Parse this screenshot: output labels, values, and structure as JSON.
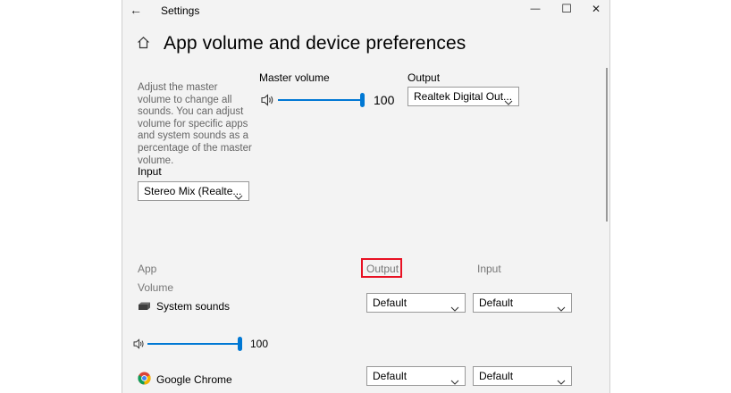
{
  "window": {
    "title": "Settings",
    "back_glyph": "←",
    "minimize_glyph": "—",
    "maximize_glyph": "☐",
    "close_glyph": "✕"
  },
  "header": {
    "home_icon": "home-icon",
    "title": "App volume and device preferences"
  },
  "description": "Adjust the master volume to change all sounds. You can adjust volume for specific apps and system sounds as a percentage of the master volume.",
  "master": {
    "label": "Master volume",
    "value": "100",
    "level": 1.0,
    "speaker_icon": "speaker-icon"
  },
  "output_device": {
    "label": "Output",
    "value": "Realtek Digital Out..."
  },
  "input_device": {
    "label": "Input",
    "value": "Stereo Mix (Realte..."
  },
  "apps_header": {
    "app": "App",
    "output": "Output",
    "input": "Input",
    "volume": "Volume"
  },
  "apps": [
    {
      "name": "System sounds",
      "volume": "100",
      "level": 1.0,
      "output": "Default",
      "input": "Default"
    },
    {
      "name": "Google Chrome",
      "output": "Default",
      "input": "Default"
    }
  ],
  "colors": {
    "accent": "#0078d4",
    "highlight_box": "#e81123",
    "window_bg": "#f3f3f3"
  }
}
